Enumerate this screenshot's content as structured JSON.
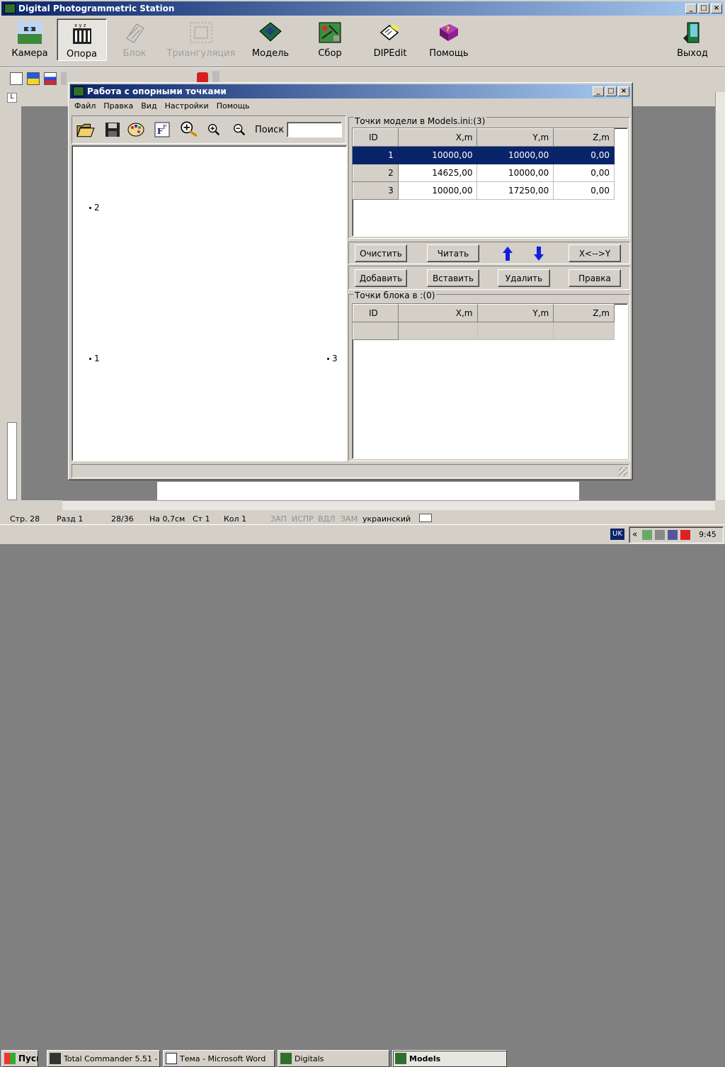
{
  "app": {
    "title": "Digital Photogrammetric Station",
    "toolbar": [
      {
        "label": "Камера",
        "icon": "camera-icon",
        "disabled": false
      },
      {
        "label": "Опора",
        "icon": "control-points-icon",
        "disabled": false
      },
      {
        "label": "Блок",
        "icon": "block-icon",
        "disabled": true
      },
      {
        "label": "Триангуляция",
        "icon": "triangulation-icon",
        "disabled": true
      },
      {
        "label": "Модель",
        "icon": "model-icon",
        "disabled": false
      },
      {
        "label": "Сбор",
        "icon": "collect-icon",
        "disabled": false
      },
      {
        "label": "DIPEdit",
        "icon": "dipedit-icon",
        "disabled": false
      },
      {
        "label": "Помощь",
        "icon": "help-book-icon",
        "disabled": false
      },
      {
        "label": "Выход",
        "icon": "exit-door-icon",
        "disabled": false
      }
    ]
  },
  "dialog": {
    "title": "Работа с опорными точками",
    "menu": [
      "Файл",
      "Правка",
      "Вид",
      "Настройки",
      "Помощь"
    ],
    "search_label": "Поиск",
    "search_value": "",
    "points": [
      {
        "id": "1"
      },
      {
        "id": "2"
      },
      {
        "id": "3"
      }
    ],
    "model_points": {
      "title": "Точки модели в Models.ini:(3)",
      "columns": [
        "ID",
        "X,m",
        "Y,m",
        "Z,m"
      ],
      "rows": [
        {
          "id": "1",
          "x": "10000,00",
          "y": "10000,00",
          "z": "0,00",
          "selected": true
        },
        {
          "id": "2",
          "x": "14625,00",
          "y": "10000,00",
          "z": "0,00",
          "selected": false
        },
        {
          "id": "3",
          "x": "10000,00",
          "y": "17250,00",
          "z": "0,00",
          "selected": false
        }
      ]
    },
    "buttons_row1": {
      "clear": "Очистить",
      "read": "Читать",
      "swap": "X<-->Y"
    },
    "buttons_row2": {
      "add": "Добавить",
      "insert": "Вставить",
      "delete": "Удалить",
      "edit": "Правка"
    },
    "block_points": {
      "title": "Точки блока в :(0)",
      "columns": [
        "ID",
        "X,m",
        "Y,m",
        "Z,m"
      ]
    }
  },
  "word_status": {
    "page": "Стр. 28",
    "section": "Разд 1",
    "pages": "28/36",
    "at": "На 0,7см",
    "line": "Ст 1",
    "col": "Кол 1",
    "rec": "ЗАП",
    "trk": "ИСПР",
    "ext": "ВДЛ",
    "ovr": "ЗАМ",
    "lang": "украинский"
  },
  "taskbar": {
    "start": "Пуск",
    "tasks": [
      "Total Commander 5.51 - ...",
      "Тема - Microsoft Word",
      "Digitals",
      "Models"
    ],
    "lang": "UK",
    "time": "9:45"
  },
  "colors": {
    "selection": "#0a246a",
    "titlebar": "#0a246a",
    "face": "#d4d0c8",
    "arrow": "#1020e0"
  }
}
